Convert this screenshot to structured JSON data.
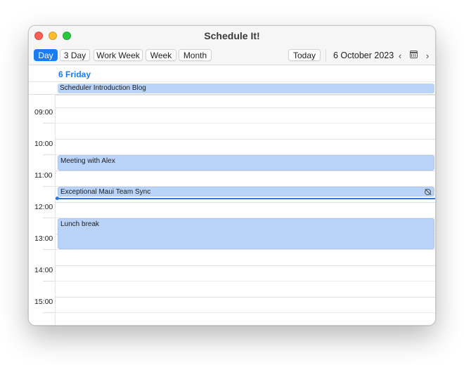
{
  "window": {
    "title": "Schedule It!"
  },
  "toolbar": {
    "views": [
      "Day",
      "3 Day",
      "Work Week",
      "Week",
      "Month"
    ],
    "active_view": "Day",
    "today_label": "Today",
    "date_label": "6 October 2023",
    "prev_icon": "chevron-left-icon",
    "next_icon": "chevron-right-icon",
    "calendar_icon": "calendar-icon"
  },
  "day": {
    "name": "6 Friday",
    "allday_event": "Scheduler Introduction Blog"
  },
  "hours": [
    "09:00",
    "10:00",
    "11:00",
    "12:00",
    "13:00",
    "14:00",
    "15:00"
  ],
  "events": [
    {
      "title": "Meeting with Alex"
    },
    {
      "title": "Exceptional Maui Team Sync",
      "icon": "recurrence-exception-icon"
    },
    {
      "title": "Lunch break"
    }
  ],
  "colors": {
    "accent": "#1a7cf5",
    "event": "#b9d3f9",
    "now_line": "#2f76d8"
  }
}
